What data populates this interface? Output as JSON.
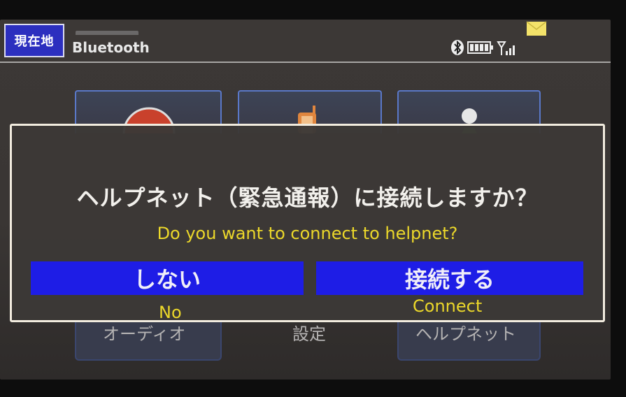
{
  "topbar": {
    "current_location_label": "現在地",
    "bluetooth_label": "Bluetooth",
    "status_icons": [
      "bluetooth-icon",
      "battery-icon",
      "signal-icon",
      "mail-icon"
    ]
  },
  "menu_tiles_bottom": {
    "left": "オーディオ",
    "center": "設定",
    "right": "ヘルプネット"
  },
  "dialog": {
    "question_jp": "ヘルプネット（緊急通報）に接続しますか？",
    "question_en": "Do you want to connect to helpnet?",
    "no_button": {
      "label": "しない",
      "sub_label": "No"
    },
    "connect_button": {
      "label": "接続する",
      "sub_label": "Connect"
    }
  },
  "colors": {
    "accent_blue": "#1e1de6",
    "subtitle_yellow": "#ecd82a",
    "dialog_border": "#f2ecdf",
    "background": "#3c3836"
  }
}
